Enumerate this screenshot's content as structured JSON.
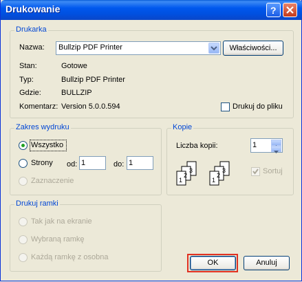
{
  "window": {
    "title": "Drukowanie"
  },
  "printer": {
    "group_title": "Drukarka",
    "name_label": "Nazwa:",
    "name_value": "Bullzip PDF Printer",
    "properties_button": "Właściwości...",
    "status_label": "Stan:",
    "status_value": "Gotowe",
    "type_label": "Typ:",
    "type_value": "Bullzip PDF Printer",
    "where_label": "Gdzie:",
    "where_value": "BULLZIP",
    "comment_label": "Komentarz:",
    "comment_value": "Version 5.0.0.594",
    "print_to_file_label": "Drukuj do pliku",
    "print_to_file_checked": false
  },
  "range": {
    "group_title": "Zakres wydruku",
    "all_label": "Wszystko",
    "pages_label": "Strony",
    "from_label": "od:",
    "from_value": "1",
    "to_label": "do:",
    "to_value": "1",
    "selection_label": "Zaznaczenie",
    "selected": "all"
  },
  "copies": {
    "group_title": "Kopie",
    "count_label": "Liczba kopii:",
    "count_value": "1",
    "collate_label": "Sortuj",
    "collate_checked": true,
    "page_numbers": [
      "1",
      "2",
      "3"
    ]
  },
  "frames": {
    "group_title": "Drukuj ramki",
    "option1": "Tak jak na ekranie",
    "option2": "Wybraną ramkę",
    "option3": "Każdą ramkę z osobna"
  },
  "buttons": {
    "ok": "OK",
    "cancel": "Anuluj"
  },
  "colors": {
    "title_bar": "#0054e3",
    "highlight": "#e03020",
    "group_title": "#0046d5"
  }
}
